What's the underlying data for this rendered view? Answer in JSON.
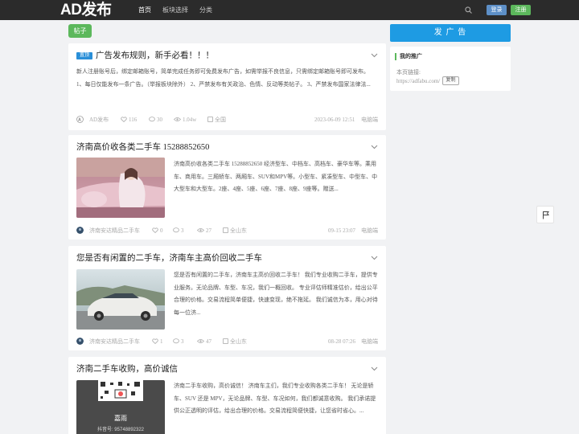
{
  "header": {
    "logo": "AD发布",
    "nav": [
      "首页",
      "板块选择",
      "分类"
    ],
    "login": "登录",
    "register": "注册"
  },
  "tag": "帖子",
  "sidebar": {
    "post_ad": "发 广 告",
    "promo_title": "我的推广",
    "promo_label": "本页链接:",
    "promo_url": "https://adfabu.com/",
    "copy": "复制"
  },
  "posts": [
    {
      "badge": "置顶",
      "title": "广告发布规则，新手必看！！！",
      "text": "新人注册账号后，绑定邮箱账号，简单完成任务即可免费发布广告，如需举报不良信息，只需绑定邮箱账号即可发布。 1、每日仅能发布一条广告。（举报板块除外） 2、严禁发布有关政治、色情、反动等类帖子。 3、严禁发布国家法律法...",
      "author": "AD发布",
      "likes": "116",
      "comments": "30",
      "views": "1.04w",
      "region": "全国",
      "date": "2023-06-09 12:51",
      "platform": "电脑端"
    },
    {
      "title": "济南高价收各类二手车 15288852650",
      "text": "济南高价收各类二手车 15288852650 经济型车、中档车、高档车、豪华车等。乘用车、商用车。三厢轿车、两厢车、SUV和MPV等。小型车、紧凑型车、中型车、中大型车和大型车。2座、4座、5座、6座、7座、8座、9座等。赠送...",
      "author": "济南安达精品二手车",
      "likes": "0",
      "comments": "3",
      "views": "27",
      "region": "全山东",
      "date": "09-15 23:07",
      "platform": "电脑端"
    },
    {
      "title": "您是否有闲置的二手车，济南车主高价回收二手车",
      "text": "您是否有闲置的二手车，济南车主高价回收二手车！ 我们专业收购二手车，提供专业服务。无论品牌、车型、车况，我们一概回收。 专业评估师精准估价，给出公平合理的价格。交易流程简单便捷，快速变现，绝不拖延。 我们诚信为本，用心对待每一位济...",
      "author": "济南安达精品二手车",
      "likes": "1",
      "comments": "3",
      "views": "47",
      "region": "全山东",
      "date": "08-28 07:26",
      "platform": "电脑端"
    },
    {
      "title": "济南二手车收购，高价诚信",
      "text": "济南二手车收购，高价诚信！ 济南车主们，我们专业收购各类二手车！ 无论是轿车、SUV 还是 MPV，无论品牌、车型、车况如何，我们都诚意收购。 我们承诺提供公正透明的评估，给出合理的价格。交易流程简便快捷，让您省时省心。...",
      "qr_name": "嘉雨",
      "qr_note": "抖音号: 95748892322"
    }
  ]
}
